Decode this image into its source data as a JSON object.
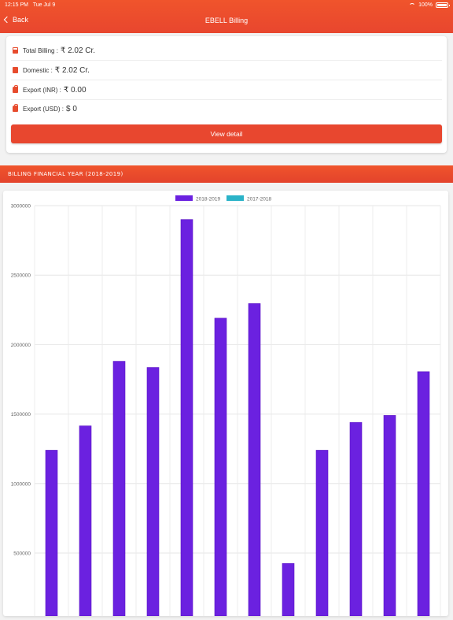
{
  "status": {
    "time": "12:15 PM",
    "date": "Tue Jul 9",
    "battery": "100%"
  },
  "nav": {
    "back_label": "Back",
    "title": "EBELL Billing"
  },
  "summary": {
    "rows": [
      {
        "icon": "calculator-icon",
        "label": "Total Billing :",
        "value": "₹ 2.02 Cr."
      },
      {
        "icon": "book-icon",
        "label": "Domestic :",
        "value": "₹ 2.02 Cr."
      },
      {
        "icon": "bag-icon",
        "label": "Export (INR) :",
        "value": "₹ 0.00"
      },
      {
        "icon": "bag-icon",
        "label": "Export (USD) :",
        "value": "$ 0"
      }
    ],
    "button_label": "View detail"
  },
  "section": {
    "title": "BILLING FINANCIAL YEAR (2018-2019)"
  },
  "colors": {
    "accent": "#e8472f",
    "series1": "#6b21e0",
    "series2": "#2bb3c8"
  },
  "chart_data": {
    "type": "bar",
    "legend_position": "top-center",
    "grid": true,
    "series": [
      {
        "name": "2018-2019",
        "color": "#6b21e0",
        "values": [
          1240000,
          1415000,
          1880000,
          1835000,
          2900000,
          2190000,
          2295000,
          425000,
          1240000,
          1440000,
          1490000,
          1805000
        ]
      },
      {
        "name": "2017-2018",
        "color": "#2bb3c8",
        "values": []
      }
    ],
    "yticks": [
      "3000000",
      "2500000",
      "2000000",
      "1500000",
      "1000000",
      "500000"
    ],
    "ylim": [
      0,
      3000000
    ]
  }
}
